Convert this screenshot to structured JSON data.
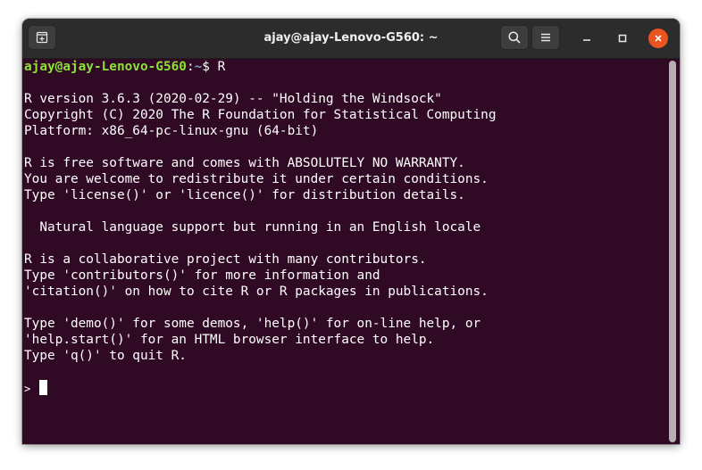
{
  "window": {
    "title": "ajay@ajay-Lenovo-G560: ~"
  },
  "colors": {
    "terminal_bg": "#300a24",
    "titlebar_bg": "#2c2c2c",
    "prompt_user": "#8ae234",
    "prompt_path": "#729fcf",
    "close_button": "#e95420"
  },
  "icons": {
    "new_tab": "new-tab-icon",
    "search": "search-icon",
    "menu": "hamburger-menu-icon",
    "minimize": "minimize-icon",
    "maximize": "maximize-icon",
    "close": "close-icon"
  },
  "terminal": {
    "prompt_user_host": "ajay@ajay-Lenovo-G560",
    "prompt_sep": ":",
    "prompt_path": "~",
    "prompt_symbol": "$ ",
    "command": "R",
    "output": [
      "",
      "R version 3.6.3 (2020-02-29) -- \"Holding the Windsock\"",
      "Copyright (C) 2020 The R Foundation for Statistical Computing",
      "Platform: x86_64-pc-linux-gnu (64-bit)",
      "",
      "R is free software and comes with ABSOLUTELY NO WARRANTY.",
      "You are welcome to redistribute it under certain conditions.",
      "Type 'license()' or 'licence()' for distribution details.",
      "",
      "  Natural language support but running in an English locale",
      "",
      "R is a collaborative project with many contributors.",
      "Type 'contributors()' for more information and",
      "'citation()' on how to cite R or R packages in publications.",
      "",
      "Type 'demo()' for some demos, 'help()' for on-line help, or",
      "'help.start()' for an HTML browser interface to help.",
      "Type 'q()' to quit R.",
      ""
    ],
    "r_prompt": ">"
  }
}
